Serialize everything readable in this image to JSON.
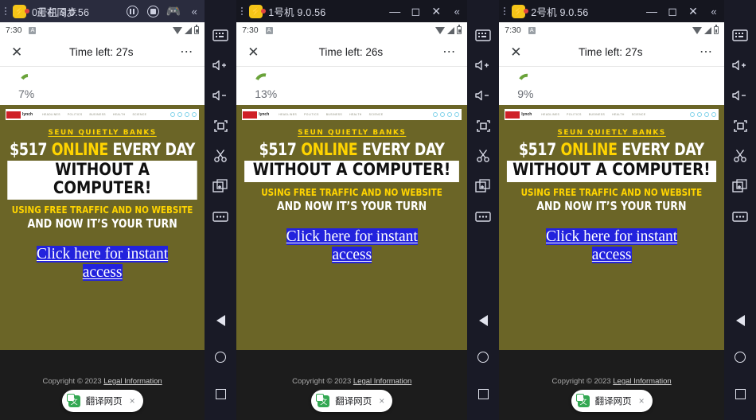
{
  "windows": [
    {
      "title": "0号机 9.0.56",
      "title_overlay": "正在同步",
      "controls": [
        "pause",
        "stop",
        "gamepad",
        "collapse"
      ],
      "status": {
        "time": "7:30",
        "app_icon": "app-badge-icon"
      },
      "page": {
        "close": "✕",
        "time_left": "Time left: 27s",
        "more": "⋯"
      },
      "progress": {
        "percent_label": "7%",
        "percent_value": 7
      },
      "toast": {
        "label": "翻译网页",
        "close": "×"
      }
    },
    {
      "title": "1号机 9.0.56",
      "title_overlay": "",
      "controls": [
        "minimize",
        "maximize",
        "close",
        "collapse"
      ],
      "status": {
        "time": "7:30",
        "app_icon": "app-badge-icon"
      },
      "page": {
        "close": "✕",
        "time_left": "Time left: 26s",
        "more": "⋯"
      },
      "progress": {
        "percent_label": "13%",
        "percent_value": 13
      },
      "toast": {
        "label": "翻译网页",
        "close": "×"
      }
    },
    {
      "title": "2号机 9.0.56",
      "title_overlay": "",
      "controls": [
        "minimize",
        "maximize",
        "close",
        "collapse"
      ],
      "status": {
        "time": "7:30",
        "app_icon": "app-badge-icon"
      },
      "page": {
        "close": "✕",
        "time_left": "Time left: 27s",
        "more": "⋯"
      },
      "progress": {
        "percent_label": "9%",
        "percent_value": 9
      },
      "toast": {
        "label": "翻译网页",
        "close": "×"
      }
    }
  ],
  "ad": {
    "banner": {
      "logo_text": "lynch",
      "nav": [
        "HEADLINES",
        "POLITICS",
        "BUSINESS",
        "HEALTH",
        "SCIENCE"
      ],
      "social_count": 4
    },
    "kicker": "SEUN QUIETLY BANKS",
    "headline_pre": "$517 ",
    "headline_em": "ONLINE",
    "headline_post": " EVERY DAY",
    "headline2": "WITHOUT A COMPUTER!",
    "sub1": "USING FREE TRAFFIC AND NO WEBSITE",
    "sub2": "AND NOW IT’S YOUR TURN",
    "cta_line1": "Click here for instant",
    "cta_line2": "access",
    "footer_copyright": "Copyright © 2023 ",
    "footer_link": "Legal Information"
  },
  "sidebar": {
    "tools": [
      {
        "name": "keyboard-icon",
        "glyph": "keyboard"
      },
      {
        "name": "volume-up-icon",
        "glyph": "vol+"
      },
      {
        "name": "volume-down-icon",
        "glyph": "vol-"
      },
      {
        "name": "fullscreen-icon",
        "glyph": "fullscreen"
      },
      {
        "name": "screenshot-scissors-icon",
        "glyph": "scissors"
      },
      {
        "name": "multi-instance-add-icon",
        "glyph": "copy-plus"
      },
      {
        "name": "more-options-icon",
        "glyph": "dots"
      }
    ],
    "nav": [
      {
        "name": "android-back-button",
        "glyph": "triangle"
      },
      {
        "name": "android-home-button",
        "glyph": "circle"
      },
      {
        "name": "android-recents-button",
        "glyph": "square"
      }
    ]
  },
  "colors": {
    "ad_background": "#6b6527",
    "accent_yellow": "#ffd400",
    "cta_blue": "#2222dd",
    "titlebar_active": "#2a2c3e",
    "sidebar": "#191a26"
  }
}
